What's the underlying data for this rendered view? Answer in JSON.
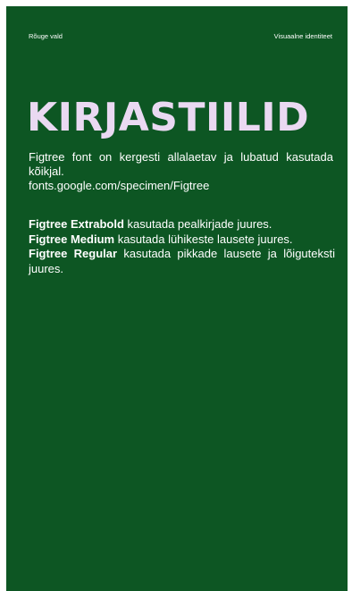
{
  "header": {
    "left": "Rõuge vald",
    "right": "Visuaalne identiteet"
  },
  "title": "KIRJASTIILID",
  "intro": {
    "text": "Figtree font on kergesti allalaetav ja lubatud kasutada kõikjal.",
    "link": "fonts.google.com/specimen/Figtree"
  },
  "usage": [
    {
      "font": "Figtree Extrabold",
      "desc": " kasutada pealkirjade juures."
    },
    {
      "font": "Figtree Medium",
      "desc": " kasutada lühikeste lausete juures."
    },
    {
      "font": "Figtree Regular",
      "desc": " kasutada pikkade lausete ja lõi­guteksti juures."
    }
  ],
  "colors": {
    "background": "#0d5623",
    "title": "#ead9f2",
    "text": "#ffffff"
  }
}
